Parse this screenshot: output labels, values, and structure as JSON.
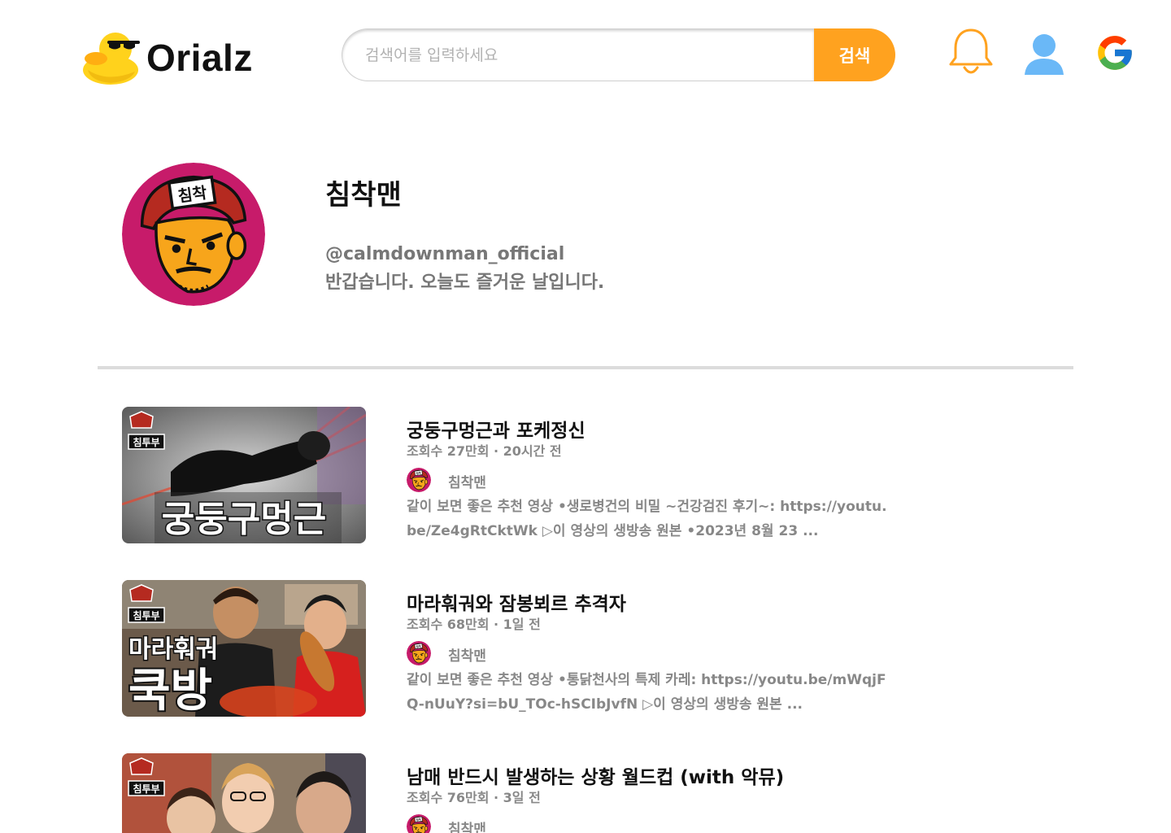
{
  "header": {
    "logo_text": "Orialz",
    "search_placeholder": "검색어를 입력하세요",
    "search_button": "검색",
    "accent_color": "#ffa21f"
  },
  "profile": {
    "name": "침착맨",
    "handle": "@calmdownman_official",
    "description": "반갑습니다. 오늘도 즐거운 날입니다."
  },
  "videos": [
    {
      "title": "궁둥구멍근과 포케정신",
      "meta": "조회수 27만회 · 20시간 전",
      "channel": "침착맨",
      "description": "같이 보면 좋은 추천 영상 •생로병건의 비밀 ~건강검진 후기~: https://youtu.be/Ze4gRtCktWk ▷이 영상의 생방송 원본 •2023년 8월 23 ...",
      "thumb_badge": "침투부",
      "thumb_text": "궁둥구멍근"
    },
    {
      "title": "마라훠궈와 잠봉뵈르 추격자",
      "meta": "조회수 68만회 · 1일 전",
      "channel": "침착맨",
      "description": "같이 보면 좋은 추천 영상 •통닭천사의 특제 카레: https://youtu.be/mWqjFQ-nUuY?si=bU_TOc-hSCIbJvfN ▷이 영상의 생방송 원본 ...",
      "thumb_badge": "침투부",
      "thumb_text_1": "마라훠궈",
      "thumb_text_2": "쿡방"
    },
    {
      "title": "남매 반드시 발생하는 상황 월드컵 (with 악뮤)",
      "meta": "조회수 76만회 · 3일 전",
      "channel": "침착맨",
      "thumb_badge": "침투부"
    }
  ],
  "icons": [
    "duck-logo-icon",
    "bell-icon",
    "user-icon",
    "google-icon"
  ]
}
